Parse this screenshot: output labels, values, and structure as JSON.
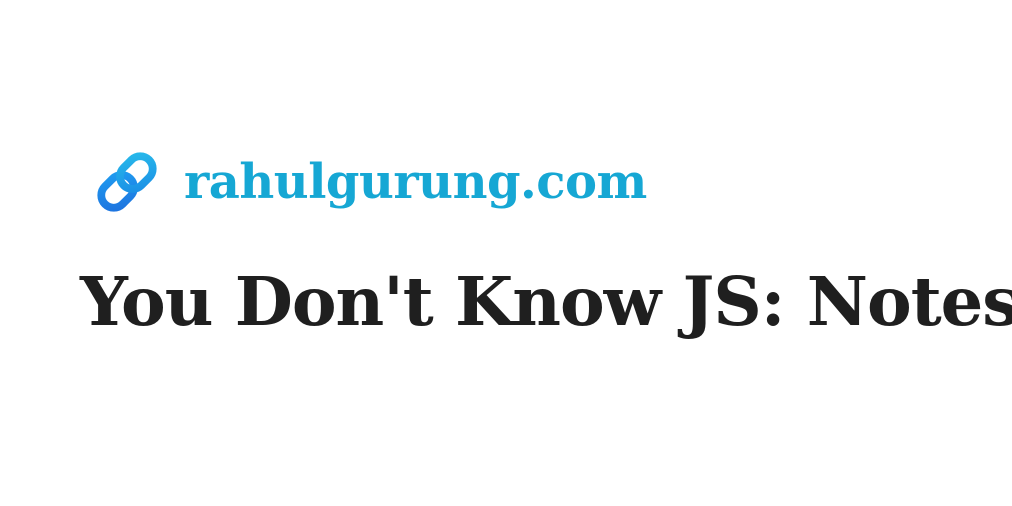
{
  "brand": {
    "icon": "link-icon",
    "url_text": "rahulgurung.com",
    "url_color": "#16a7d4",
    "icon_colors": [
      "#1f7ee8",
      "#22b2e6"
    ]
  },
  "title": "You Don't Know JS: Notes"
}
